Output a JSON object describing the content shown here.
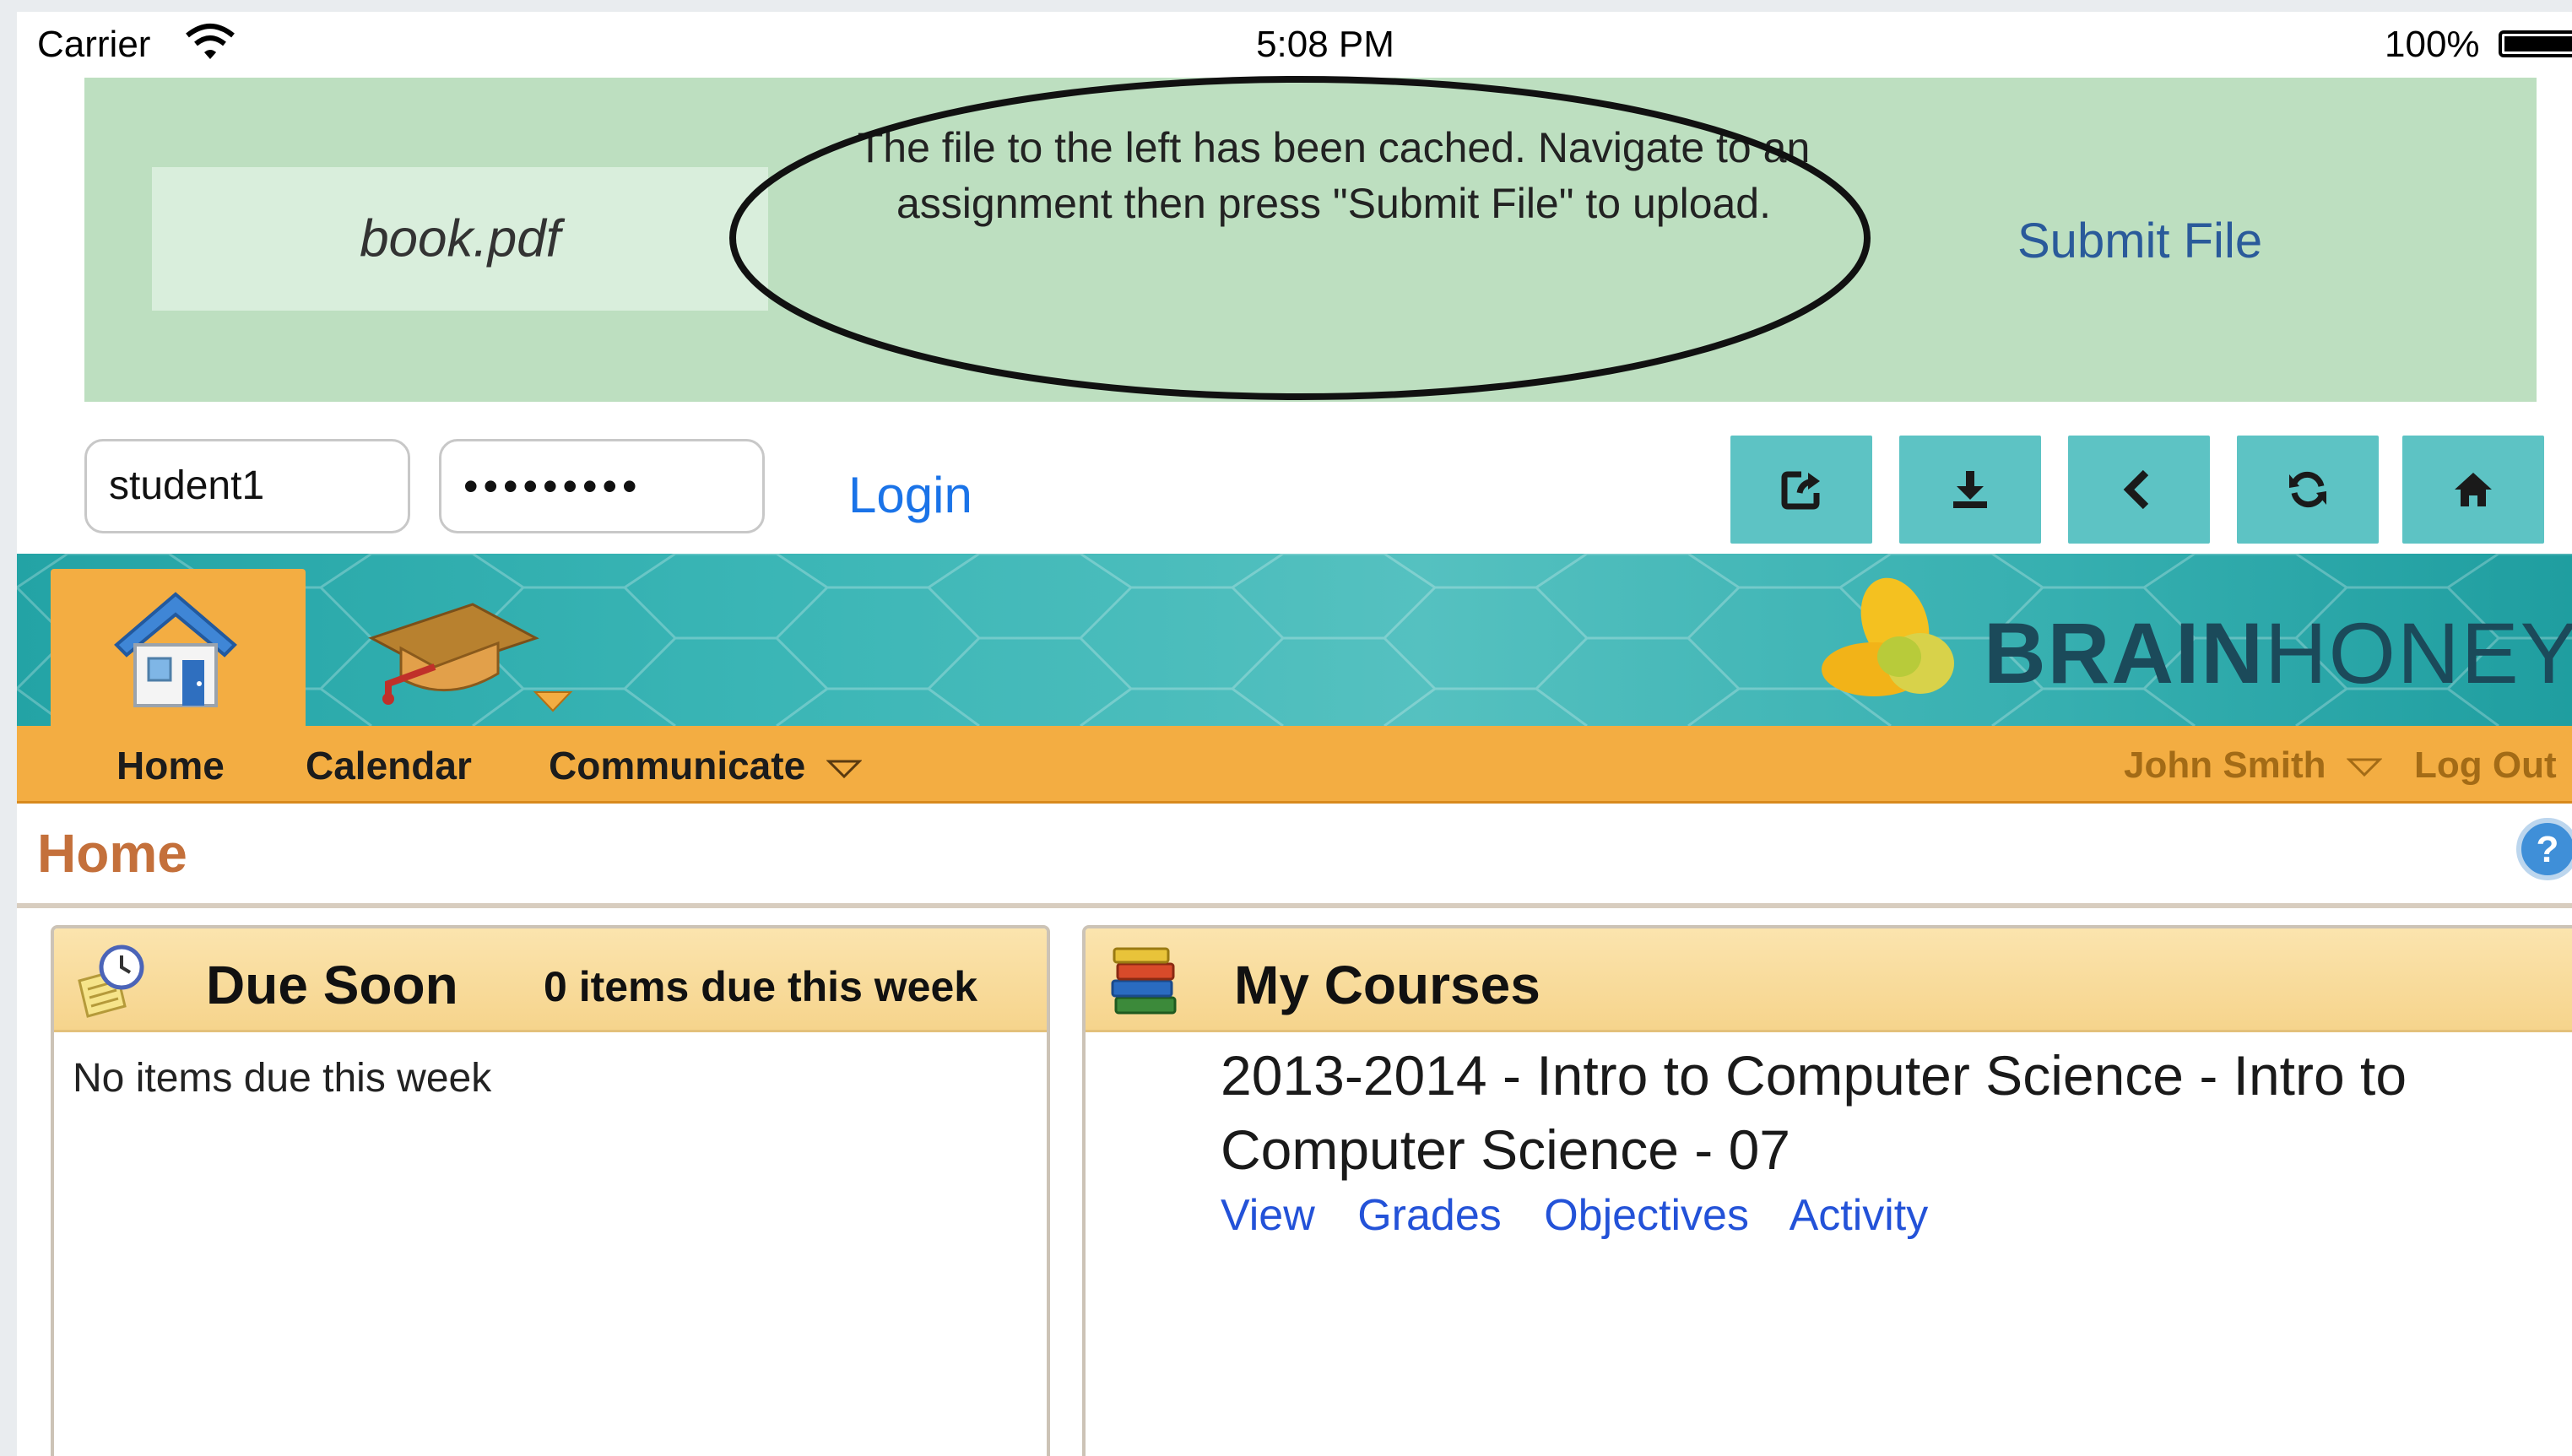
{
  "status_bar": {
    "carrier": "Carrier",
    "time": "5:08 PM",
    "battery": "100%"
  },
  "cache_notice": {
    "file_name": "book.pdf",
    "message": "The file to the left has been cached. Navigate to an assignment then press \"Submit File\" to upload.",
    "submit_label": "Submit File"
  },
  "login": {
    "username_value": "student1",
    "password_value": "•••••••••",
    "login_label": "Login"
  },
  "toolbar": {
    "buttons": [
      "share-icon",
      "download-icon",
      "back-icon",
      "refresh-icon",
      "home-icon"
    ],
    "button_color": "#5dc3c4"
  },
  "header": {
    "brand_bold": "BRAIN",
    "brand_light": "HONEY",
    "trademark": "™",
    "accent": "#f3ad42",
    "teal": "#36afb0"
  },
  "nav": {
    "home": "Home",
    "calendar": "Calendar",
    "communicate": "Communicate",
    "user": "John Smith",
    "logout": "Log Out"
  },
  "page": {
    "title": "Home"
  },
  "due_soon": {
    "title": "Due Soon",
    "subtitle": "0 items due this week",
    "empty": "No items due this week"
  },
  "courses": {
    "title": "My Courses",
    "items": [
      {
        "name": "2013-2014 - Intro to Computer Science - Intro to Computer Science - 07",
        "links": [
          "View",
          "Grades",
          "Objectives",
          "Activity"
        ]
      }
    ]
  }
}
